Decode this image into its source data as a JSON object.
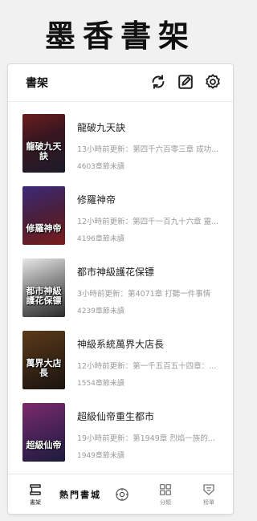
{
  "banner": {
    "title": "墨香書架"
  },
  "header": {
    "title": "書架",
    "icons": [
      "refresh-icon",
      "edit-icon",
      "settings-icon"
    ]
  },
  "books": [
    {
      "title": "龍破九天訣",
      "update": "13小時前更新：第四千六百零三章 成功...",
      "unread": "4603章節未讀",
      "cover_text": "龍破九天訣",
      "cover_colors": [
        "#6b1d1d",
        "#1b1c2a"
      ]
    },
    {
      "title": "修羅神帝",
      "update": "12小時前更新：第四千一百九十六章 靈...",
      "unread": "4196章節未讀",
      "cover_text": "修羅神帝",
      "cover_colors": [
        "#3d2a7a",
        "#7a1c1c"
      ]
    },
    {
      "title": "都市神級護花保镖",
      "update": "3小時前更新：第4071章 打聽一件事情",
      "unread": "4239章節未讀",
      "cover_text": "都市神級護花保镖",
      "cover_colors": [
        "#e8e8e8",
        "#2a2a2a"
      ]
    },
    {
      "title": "神級系統萬界大店長",
      "update": "12小時前更新：第一千五百五十四章：...",
      "unread": "1554章節未讀",
      "cover_text": "萬界大店長",
      "cover_colors": [
        "#5a3a1a",
        "#1a1410"
      ]
    },
    {
      "title": "超級仙帝重生都市",
      "update": "19小時前更新：第1949章 烈焰一族的...",
      "unread": "1949章節未讀",
      "cover_text": "超級仙帝",
      "cover_colors": [
        "#7a2a6a",
        "#1c1c3a"
      ]
    }
  ],
  "tabbar": {
    "bookshelf_label": "書架",
    "hot_text": "熱門書城",
    "category_label": "分類",
    "ranking_label": "榜單"
  }
}
